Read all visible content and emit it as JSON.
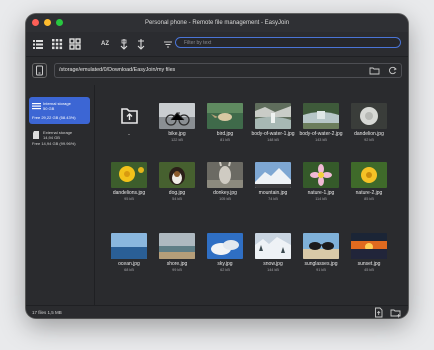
{
  "window": {
    "title": "Personal phone - Remote file management - EasyJoin"
  },
  "toolbar": {
    "filter_placeholder": "Filter by text",
    "sort_label": "AZ"
  },
  "path": {
    "current": "/storage/emulated/0/Download/EasyJoin/my files"
  },
  "sidebar": {
    "items": [
      {
        "title": "Internal storage",
        "size": "50 GB",
        "free": "Free 29,22 GB (58.43%)"
      },
      {
        "title": "External storage",
        "size": "14,94 GB",
        "free": "Free 14,94 GB (99.96%)"
      }
    ]
  },
  "files": [
    {
      "name": "..",
      "size": ""
    },
    {
      "name": "bike.jpg",
      "size": "122 kB"
    },
    {
      "name": "bird.jpg",
      "size": "81 kB"
    },
    {
      "name": "body-of-water-1.jpg",
      "size": "148 kB"
    },
    {
      "name": "body-of-water-2.jpg",
      "size": "143 kB"
    },
    {
      "name": "dandelion.jpg",
      "size": "92 kB"
    },
    {
      "name": "dandelions.jpg",
      "size": "95 kB"
    },
    {
      "name": "dog.jpg",
      "size": "54 kB"
    },
    {
      "name": "donkey.jpg",
      "size": "105 kB"
    },
    {
      "name": "mountain.jpg",
      "size": "74 kB"
    },
    {
      "name": "nature-1.jpg",
      "size": "114 kB"
    },
    {
      "name": "nature-2.jpg",
      "size": "85 kB"
    },
    {
      "name": "ocean.jpg",
      "size": "68 kB"
    },
    {
      "name": "shore.jpg",
      "size": "99 kB"
    },
    {
      "name": "sky.jpg",
      "size": "62 kB"
    },
    {
      "name": "snow.jpg",
      "size": "144 kB"
    },
    {
      "name": "sunglasses.jpg",
      "size": "91 kB"
    },
    {
      "name": "sunset.jpg",
      "size": "45 kB"
    }
  ],
  "status": {
    "summary": "17 files  1,5 MB"
  },
  "colors": {
    "accent": "#3c66d4",
    "window_bg": "#2a2b2e"
  }
}
